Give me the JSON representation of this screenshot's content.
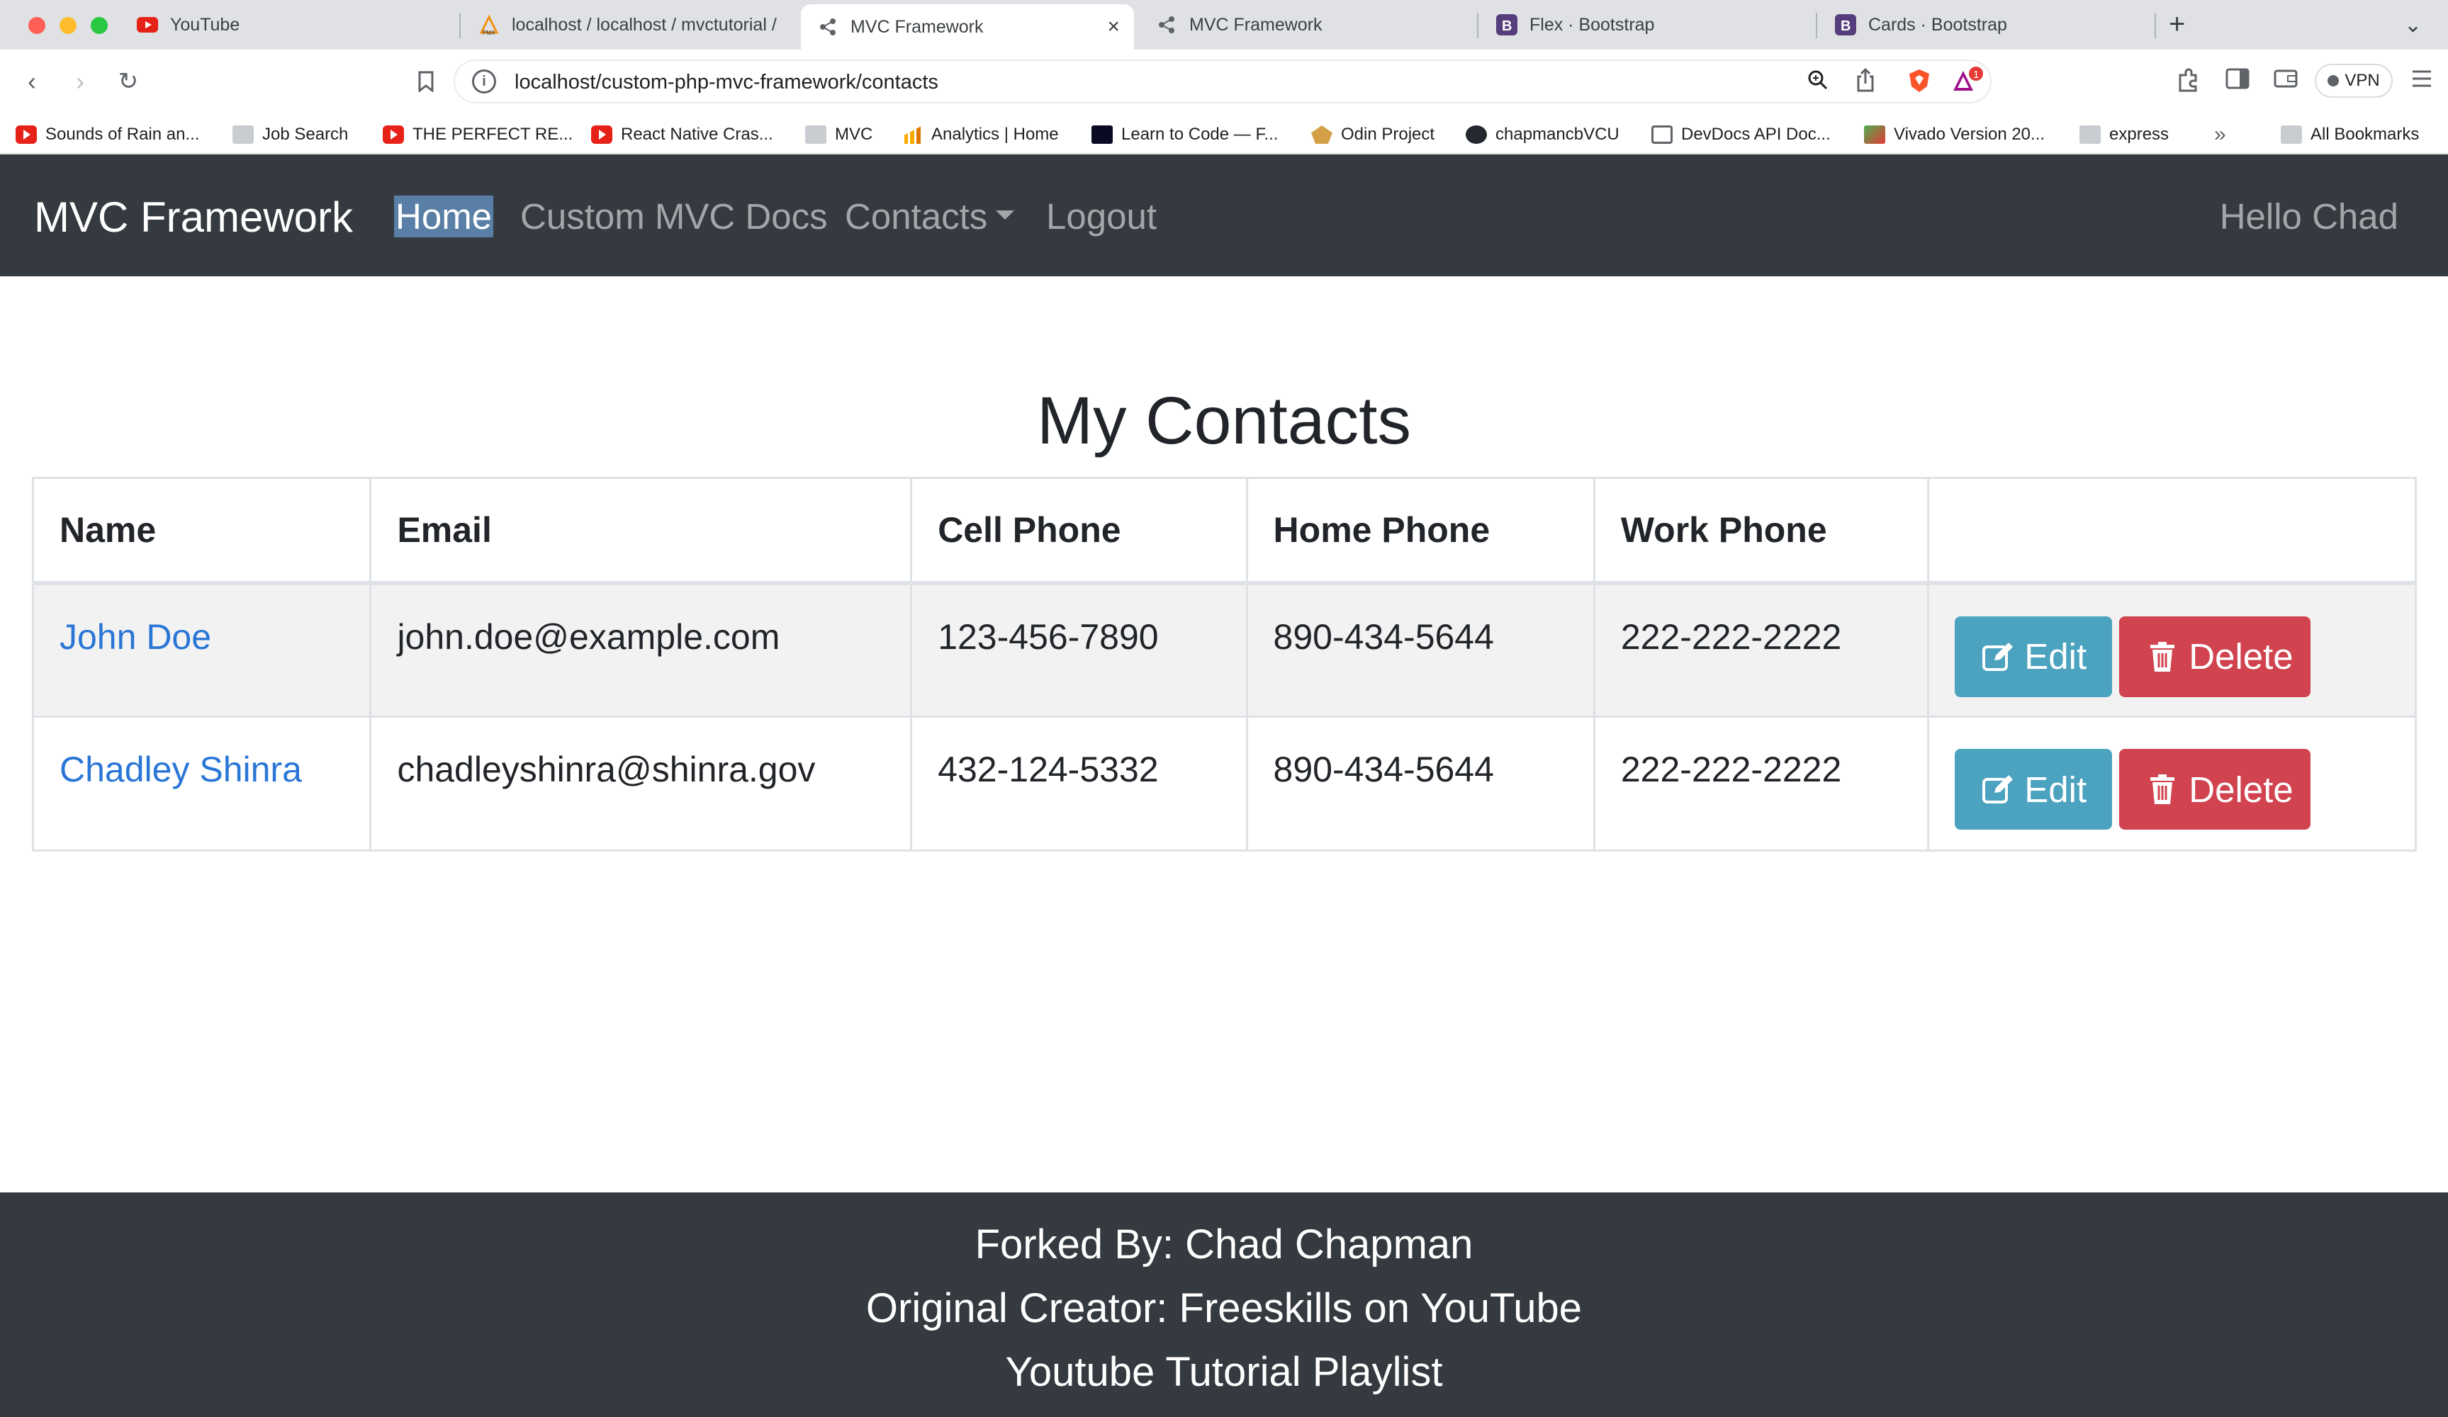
{
  "browser": {
    "tabs": [
      {
        "title": "YouTube",
        "icon": "youtube-icon"
      },
      {
        "title": "localhost / localhost / mvctutorial /",
        "icon": "phpmyadmin-icon"
      },
      {
        "title": "MVC Framework",
        "icon": "network-icon",
        "active": true
      },
      {
        "title": "MVC Framework",
        "icon": "network-icon"
      },
      {
        "title": "Flex · Bootstrap",
        "icon": "bootstrap-icon"
      },
      {
        "title": "Cards · Bootstrap",
        "icon": "bootstrap-icon"
      }
    ],
    "url": "localhost/custom-php-mvc-framework/contacts",
    "vpn_label": "VPN",
    "notification_count": "1",
    "bookmarks": [
      {
        "label": "Sounds of Rain an...",
        "icon": "youtube-icon"
      },
      {
        "label": "Job Search",
        "icon": "folder-icon"
      },
      {
        "label": "THE PERFECT RE...",
        "icon": "youtube-icon"
      },
      {
        "label": "React Native Cras...",
        "icon": "youtube-icon"
      },
      {
        "label": "MVC",
        "icon": "folder-icon"
      },
      {
        "label": "Analytics | Home",
        "icon": "analytics-icon"
      },
      {
        "label": "Learn to Code — F...",
        "icon": "freecodecamp-icon"
      },
      {
        "label": "Odin Project",
        "icon": "odin-icon"
      },
      {
        "label": "chapmancbVCU",
        "icon": "github-icon"
      },
      {
        "label": "DevDocs API Doc...",
        "icon": "devdocs-icon"
      },
      {
        "label": "Vivado Version 20...",
        "icon": "vivado-icon"
      },
      {
        "label": "express",
        "icon": "folder-icon"
      }
    ],
    "bookmarks_overflow": "»",
    "all_bookmarks": "All Bookmarks"
  },
  "navbar": {
    "brand": "MVC Framework",
    "links": {
      "home": "Home",
      "docs": "Custom MVC Docs",
      "contacts": "Contacts",
      "logout": "Logout"
    },
    "greeting": "Hello Chad"
  },
  "main": {
    "title": "My Contacts",
    "columns": [
      "Name",
      "Email",
      "Cell Phone",
      "Home Phone",
      "Work Phone",
      ""
    ],
    "rows": [
      {
        "name": "John Doe",
        "email": "john.doe@example.com",
        "cell": "123-456-7890",
        "home": "890-434-5644",
        "work": "222-222-2222"
      },
      {
        "name": "Chadley Shinra",
        "email": "chadleyshinra@shinra.gov",
        "cell": "432-124-5332",
        "home": "890-434-5644",
        "work": "222-222-2222"
      }
    ],
    "edit_label": "Edit",
    "delete_label": "Delete"
  },
  "footer": {
    "forked_by": "Forked By: Chad Chapman",
    "original": "Original Creator: Freeskills on YouTube",
    "playlist": "Youtube Tutorial Playlist"
  },
  "colors": {
    "navbar_bg": "#343a40",
    "link": "#2a76d6",
    "edit_btn": "#4ba3bf",
    "delete_btn": "#d0434f"
  }
}
